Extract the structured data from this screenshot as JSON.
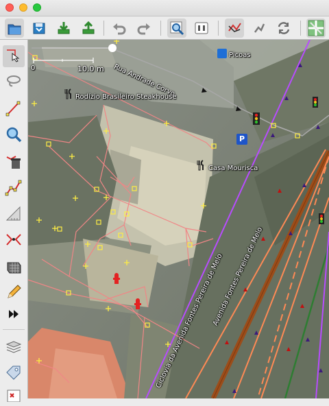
{
  "titlebar": {
    "buttons": [
      "close",
      "minimize",
      "zoom"
    ]
  },
  "toolbar": {
    "buttons": [
      {
        "name": "open-file-icon"
      },
      {
        "name": "save-icon"
      },
      {
        "name": "download-icon"
      },
      {
        "name": "upload-icon"
      },
      {
        "name": "undo-icon"
      },
      {
        "name": "redo-icon"
      },
      {
        "name": "zoom-to-selection-icon"
      },
      {
        "name": "preferences-icon"
      },
      {
        "name": "wireframe-toggle-icon"
      },
      {
        "name": "select-icon"
      },
      {
        "name": "refresh-icon"
      },
      {
        "name": "map-paint-style-icon"
      }
    ]
  },
  "sidebar": {
    "tools": [
      "select-tool-icon",
      "lasso-tool-icon",
      "draw-tool-icon",
      "zoom-tool-icon",
      "delete-tool-icon",
      "combine-way-icon",
      "measure-tool-icon",
      "split-way-icon",
      "building-tool-icon",
      "pencil-tool-icon",
      "more-tools-icon"
    ],
    "panels": [
      "layers-panel-icon",
      "tags-panel-icon",
      "properties-panel-icon"
    ]
  },
  "map": {
    "scale": {
      "start": "0",
      "end": "10.0 m"
    },
    "labels": {
      "street_top": "Rua Andrade Corvo",
      "poi_ricoas": "Picoas",
      "poi_rodizio": "Rodízio Brasileiro Steakhouse",
      "poi_casa": "Casa Mourisca",
      "street_cycle": "Ciclovia da Avenida Fontes Pereira de Melo",
      "street_avenue": "Avenida Fontes Pereira de Melo"
    },
    "colors": {
      "cycleway": "#b84cff",
      "avenue_edge": "#ff8a55",
      "avenue_center": "#9c4d1a",
      "bus_route": "#2e7d32",
      "building_outline": "#f08686",
      "node": "#ffee44"
    }
  }
}
